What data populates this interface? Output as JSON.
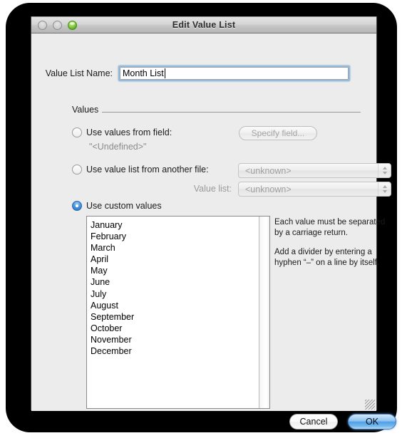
{
  "window": {
    "title": "Edit Value List",
    "traffic_lights": [
      {
        "name": "close",
        "state": "inactive"
      },
      {
        "name": "minimize",
        "state": "inactive"
      },
      {
        "name": "zoom",
        "state": "green"
      }
    ]
  },
  "form": {
    "name_label": "Value List Name:",
    "name_value": "Month List",
    "name_placeholder": ""
  },
  "group": {
    "title": "Values"
  },
  "options": [
    {
      "id": "from-field",
      "label": "Use values from field:",
      "selected": false,
      "button_label": "Specify field...",
      "button_enabled": false,
      "subtext": "\"<Undefined>\""
    },
    {
      "id": "from-file",
      "label": "Use value list from another file:",
      "selected": false,
      "popup_value": "<unknown>",
      "popup_enabled": false,
      "sub_label": "Value list:",
      "sub_popup_value": "<unknown>",
      "sub_popup_enabled": false
    },
    {
      "id": "custom",
      "label": "Use custom values",
      "selected": true
    }
  ],
  "custom_values": [
    "January",
    "February",
    "March",
    "April",
    "May",
    "June",
    "July",
    "August",
    "September",
    "October",
    "November",
    "December"
  ],
  "help": {
    "paragraph1": "Each value must be separated by a carriage return.",
    "paragraph2": "Add a divider by entering a hyphen “–” on a line by itself."
  },
  "buttons": {
    "cancel": "Cancel",
    "ok": "OK"
  },
  "colors": {
    "accent_blue": "#4e9ee6",
    "focus_ring": "#96bada",
    "radio_on": "#1f6fc4",
    "disabled_text": "#a0a0a0",
    "window_bg": "#ececec",
    "backdrop": "#000000"
  }
}
